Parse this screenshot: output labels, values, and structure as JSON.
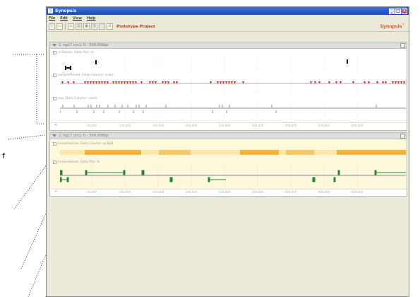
{
  "window": {
    "title": "Synopsis",
    "buttons": [
      "_",
      "□",
      "×"
    ]
  },
  "menu": [
    "File",
    "Edit",
    "View",
    "Help"
  ],
  "toolbar": {
    "project_label": "Prototype Project",
    "brand": "Synopsis",
    "brand_mark": "™",
    "tools": [
      "zoom-icon",
      "open-icon",
      "new-icon",
      "import-icon",
      "layout-icon",
      "print-icon",
      "export-icon",
      "refresh-icon"
    ]
  },
  "panel1": {
    "header": "1: hg17 chr1: 0 - 500,000bp",
    "tracks": [
      {
        "label": "cnSweep: Data Pair: fx"
      },
      {
        "label": "samplePeeled: Data Column: score"
      },
      {
        "label": "snp: Data Column: score"
      }
    ]
  },
  "panel2": {
    "header": "2: hg17 chr1: 0 - 500,000bp",
    "tracks": [
      {
        "label": "knownGenes: Data Column: gcBpB"
      },
      {
        "label": "knownGenes: Data Pair: fx"
      }
    ]
  },
  "axis": {
    "ticks": [
      "50,000",
      "100,000",
      "150,000",
      "200,000",
      "250,000",
      "300,000",
      "350,000",
      "400,000",
      "450,000"
    ]
  },
  "side_letter": "f"
}
